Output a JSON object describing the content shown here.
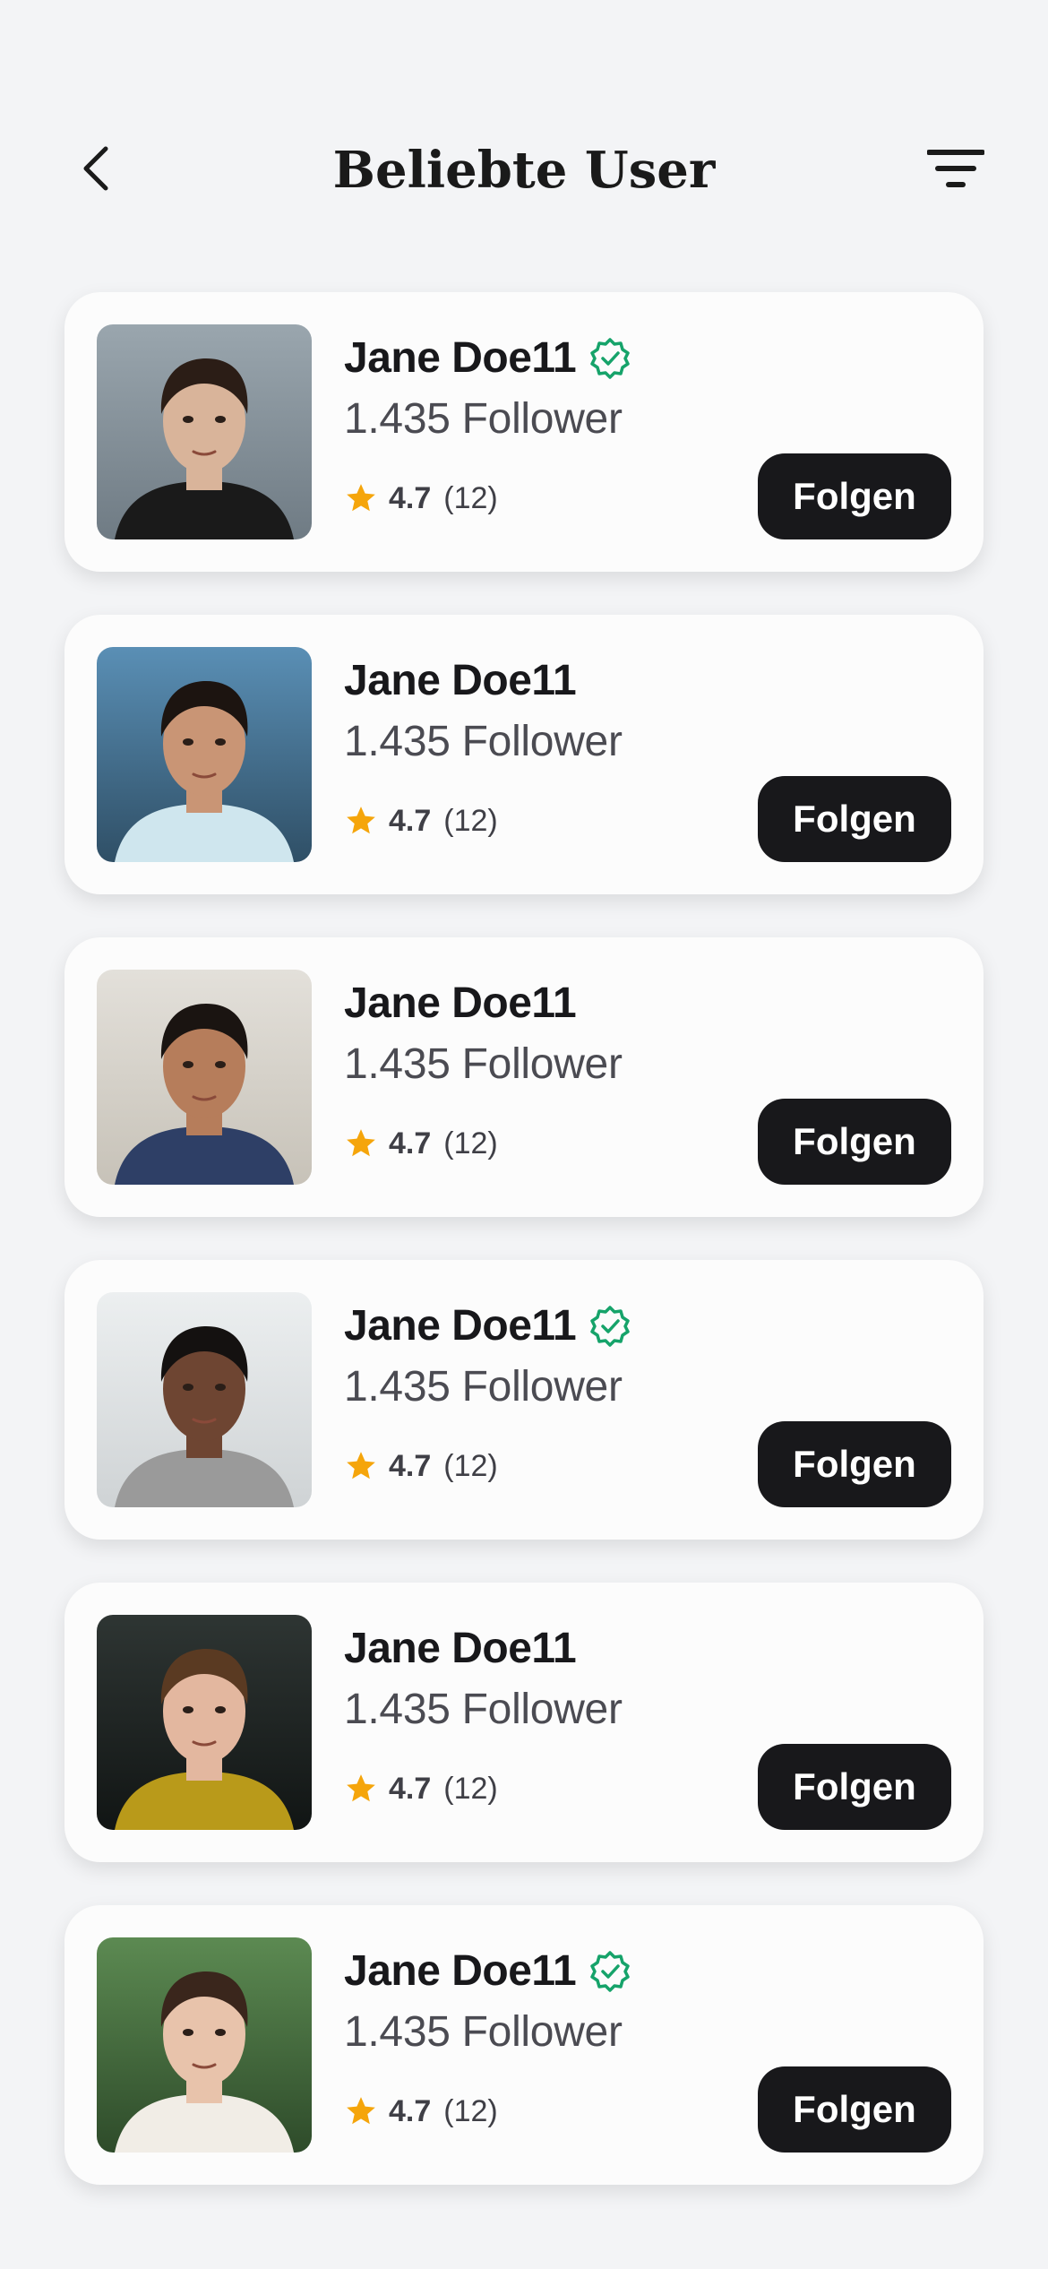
{
  "header": {
    "title": "Beliebte User",
    "back_icon": "chevron-left-icon",
    "filter_icon": "filter-icon"
  },
  "colors": {
    "background": "#f3f4f6",
    "card": "#fcfcfc",
    "button": "#18181b",
    "verified": "#16a36a",
    "star": "#f5a50b"
  },
  "users": [
    {
      "name": "Jane Doe11",
      "followers": "1.435 Follower",
      "rating": "4.7",
      "count": "(12)",
      "button": "Folgen",
      "verified": true
    },
    {
      "name": "Jane Doe11",
      "followers": "1.435 Follower",
      "rating": "4.7",
      "count": "(12)",
      "button": "Folgen",
      "verified": false
    },
    {
      "name": "Jane Doe11",
      "followers": "1.435 Follower",
      "rating": "4.7",
      "count": "(12)",
      "button": "Folgen",
      "verified": false
    },
    {
      "name": "Jane Doe11",
      "followers": "1.435 Follower",
      "rating": "4.7",
      "count": "(12)",
      "button": "Folgen",
      "verified": true
    },
    {
      "name": "Jane Doe11",
      "followers": "1.435 Follower",
      "rating": "4.7",
      "count": "(12)",
      "button": "Folgen",
      "verified": false
    },
    {
      "name": "Jane Doe11",
      "followers": "1.435 Follower",
      "rating": "4.7",
      "count": "(12)",
      "button": "Folgen",
      "verified": true
    }
  ]
}
